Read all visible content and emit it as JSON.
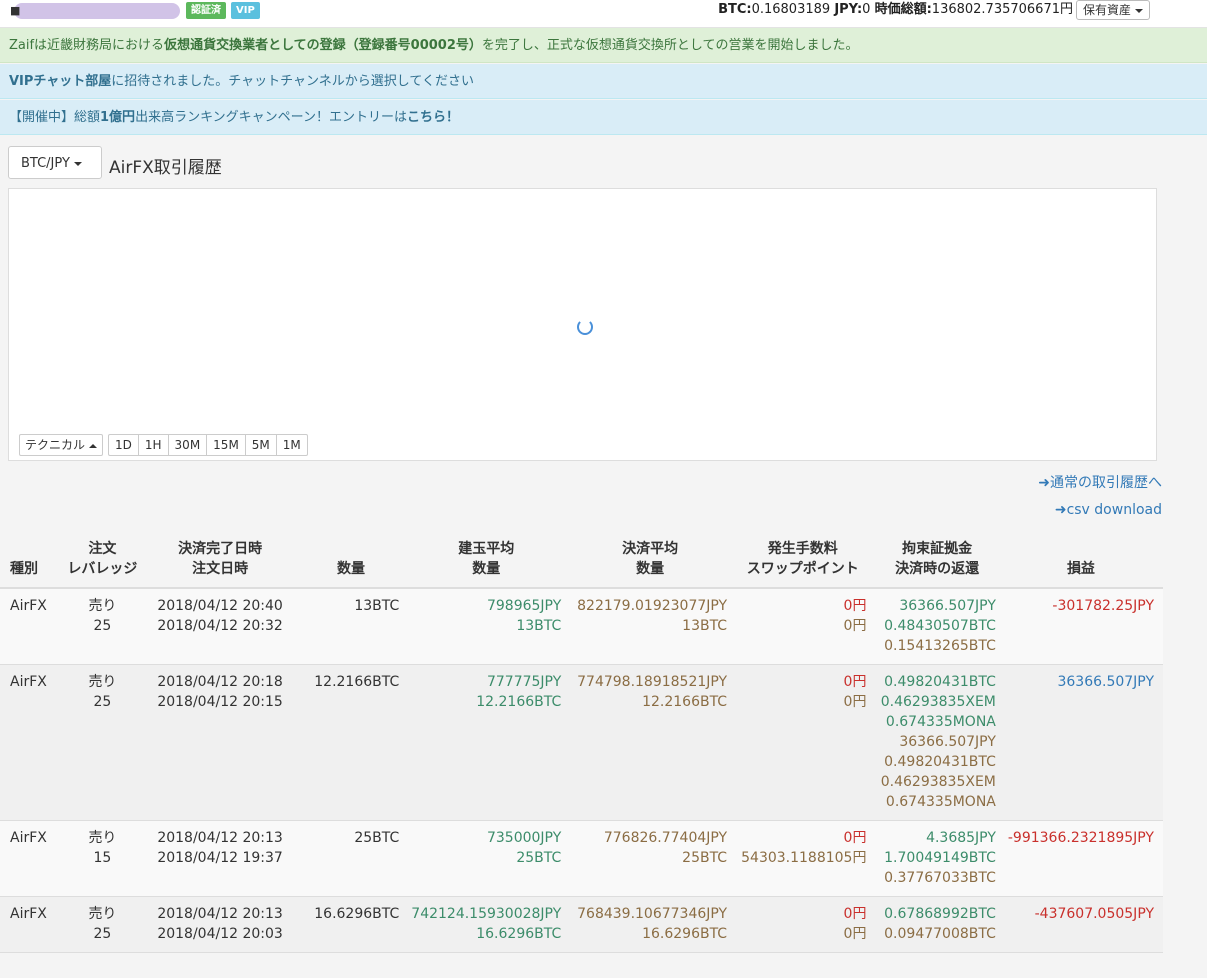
{
  "header": {
    "user_icon": "user-icon",
    "badge_verified": "認証済",
    "badge_vip": "VIP",
    "btc_label": "BTC:",
    "btc_value": "0.16803189",
    "jpy_label": "JPY:",
    "jpy_value": "0",
    "total_label": "時価総額:",
    "total_value": "136802.735706671円",
    "assets_button": "保有資産"
  },
  "alerts": {
    "success_pre": "Zaifは近畿財務局における",
    "success_bold": "仮想通貨交換業者としての登録（登録番号00002号）",
    "success_post": "を完了し、正式な仮想通貨交換所としての営業を開始しました。",
    "vip_bold": "VIPチャット部屋",
    "vip_post": "に招待されました。チャットチャンネルから選択してください",
    "campaign_pre": "【開催中】総額",
    "campaign_bold1": "1億円",
    "campaign_mid": "出来高ランキングキャンペーン！エントリーは",
    "campaign_bold2": "こちら！"
  },
  "pair_selector": "BTC/JPY",
  "page_title": "AirFX取引履歴",
  "chart": {
    "technical_button": "テクニカル",
    "timeframes": [
      "1D",
      "1H",
      "30M",
      "15M",
      "5M",
      "1M"
    ]
  },
  "links": {
    "normal_history": "通常の取引履歴へ",
    "csv_download": "csv download"
  },
  "table": {
    "headers": {
      "type": "種別",
      "order_1": "注文",
      "order_2": "レバレッジ",
      "date_1": "決済完了日時",
      "date_2": "注文日時",
      "amount": "数量",
      "open_1": "建玉平均",
      "open_2": "数量",
      "close_1": "決済平均",
      "close_2": "数量",
      "fee_1": "発生手数料",
      "fee_2": "スワップポイント",
      "margin_1": "拘束証拠金",
      "margin_2": "決済時の返還",
      "pl": "損益"
    },
    "rows": [
      {
        "type": "AirFX",
        "side": "売り",
        "leverage": "25",
        "settled": "2018/04/12 20:40",
        "ordered": "2018/04/12 20:32",
        "amount": "13BTC",
        "open_avg": "798965JPY",
        "open_qty": "13BTC",
        "close_avg": "822179.01923077JPY",
        "close_qty": "13BTC",
        "fee": "0円",
        "swap": "0円",
        "margin": [
          "36366.507JPY",
          "0.48430507BTC",
          "0.15413265BTC"
        ],
        "pl": "-301782.25JPY"
      },
      {
        "type": "AirFX",
        "side": "売り",
        "leverage": "25",
        "settled": "2018/04/12 20:18",
        "ordered": "2018/04/12 20:15",
        "amount": "12.2166BTC",
        "open_avg": "777775JPY",
        "open_qty": "12.2166BTC",
        "close_avg": "774798.18918521JPY",
        "close_qty": "12.2166BTC",
        "fee": "0円",
        "swap": "0円",
        "margin": [
          "0.49820431BTC",
          "0.46293835XEM",
          "0.674335MONA",
          "36366.507JPY",
          "0.49820431BTC",
          "0.46293835XEM",
          "0.674335MONA"
        ],
        "pl": "36366.507JPY"
      },
      {
        "type": "AirFX",
        "side": "売り",
        "leverage": "15",
        "settled": "2018/04/12 20:13",
        "ordered": "2018/04/12 19:37",
        "amount": "25BTC",
        "open_avg": "735000JPY",
        "open_qty": "25BTC",
        "close_avg": "776826.77404JPY",
        "close_qty": "25BTC",
        "fee": "0円",
        "swap": "54303.1188105円",
        "margin": [
          "4.3685JPY",
          "1.70049149BTC",
          "0.37767033BTC"
        ],
        "pl": "-991366.2321895JPY"
      },
      {
        "type": "AirFX",
        "side": "売り",
        "leverage": "25",
        "settled": "2018/04/12 20:13",
        "ordered": "2018/04/12 20:03",
        "amount": "16.6296BTC",
        "open_avg": "742124.15930028JPY",
        "open_qty": "16.6296BTC",
        "close_avg": "768439.10677346JPY",
        "close_qty": "16.6296BTC",
        "fee": "0円",
        "swap": "0円",
        "margin": [
          "0.67868992BTC",
          "0.09477008BTC"
        ],
        "pl": "-437607.0505JPY"
      }
    ]
  },
  "colors": {
    "success_bg": "#dff0d8",
    "info_bg": "#d9edf7",
    "link": "#337ab7",
    "positive_green": "#3c8c6a",
    "neutral_brown": "#8b6d44",
    "loss_red": "#c9302c"
  }
}
